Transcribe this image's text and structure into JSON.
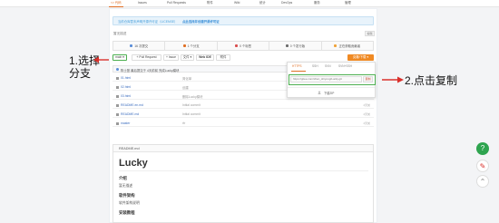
{
  "nav": {
    "tabs": [
      {
        "label": "<> 代码",
        "active": true
      },
      {
        "label": "Issues",
        "count": "0"
      },
      {
        "label": "Pull Requests",
        "count": "0"
      },
      {
        "label": "附件",
        "count": "0"
      },
      {
        "label": "Wiki",
        "count": "0"
      },
      {
        "label": "统计"
      },
      {
        "label": "DevOps"
      },
      {
        "label": "服务"
      },
      {
        "label": "管理"
      }
    ]
  },
  "banner": {
    "text": "当前仓库暂未声明开源许可证（LICENSE）",
    "link": "点此选择并创建开源许可证"
  },
  "description": "暂无描述",
  "edit_label": "编辑",
  "stats": [
    {
      "label": "16 次提交",
      "color": "#5b8ed8"
    },
    {
      "label": "1 个分支",
      "color": "#e06f24"
    },
    {
      "label": "0 个标签",
      "color": "#d94f4f"
    },
    {
      "label": "0 个发行版",
      "color": "#6c6c6c"
    },
    {
      "label": "正在获取贡献者",
      "color": "#f0a33a"
    }
  ],
  "toolbar": {
    "branch": "main ▾",
    "pull_request": "+ Pull Request",
    "issue": "+ Issue",
    "file": "文件 ▾",
    "webide": "Web IDE",
    "attachment": "附件",
    "clone": "克隆/下载 ▾"
  },
  "commit": {
    "text": "陈士登 最后提交于 4天前前 完成Lucky模块"
  },
  "files": [
    {
      "name": "01.html",
      "msg": "简化单",
      "date": "4天前"
    },
    {
      "name": "02.html",
      "msg": "创建",
      "date": "4天前"
    },
    {
      "name": "03.html",
      "msg": "删除Lucky模块",
      "date": "4天前"
    },
    {
      "name": "README.en.md",
      "msg": "Initial commit",
      "date": "4天前"
    },
    {
      "name": "README.md",
      "msg": "Initial commit",
      "date": "4天前"
    },
    {
      "name": "master",
      "msg": "rfr",
      "date": "4天前"
    }
  ],
  "readme": {
    "header": "README.md",
    "title": "Lucky",
    "sections": [
      {
        "kind": "h",
        "text": "介绍"
      },
      {
        "kind": "p",
        "text": "暂无描述"
      },
      {
        "kind": "h",
        "text": "软件架构"
      },
      {
        "kind": "p",
        "text": "软件架构说明"
      },
      {
        "kind": "h",
        "text": "安装教程"
      }
    ]
  },
  "popup": {
    "tabs": [
      "HTTPS",
      "SSH",
      "SVN",
      "SVN+SSH"
    ],
    "url": "https://gitee.com/chen_shiyong/Lucky.git",
    "copy_label": "复制",
    "download_label": "下载ZIP"
  },
  "annotations": {
    "left_line1": "1.选择",
    "left_line2": "分支",
    "right": "2.点击复制",
    "color": "#d9302b"
  },
  "colors": {
    "accent": "#e06f24",
    "highlight_box": "#4caf50",
    "link": "#3d6ebf"
  }
}
